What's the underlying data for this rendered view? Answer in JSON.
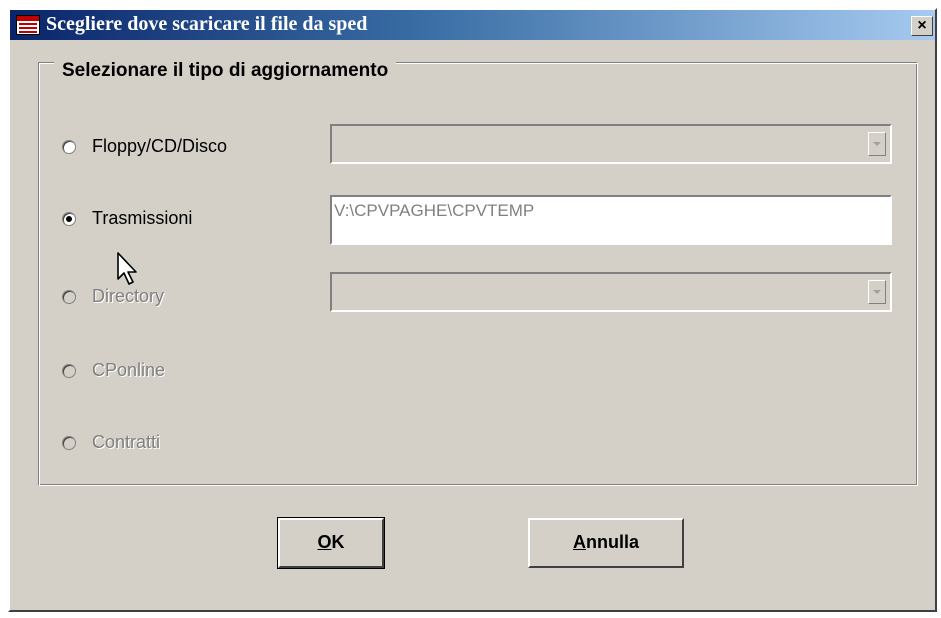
{
  "window": {
    "title": "Scegliere dove scaricare il file da sped",
    "close_glyph": "×",
    "app_icon": "window-app-icon"
  },
  "group": {
    "label": "Selezionare il tipo di aggiornamento"
  },
  "options": [
    {
      "label": "Floppy/CD/Disco",
      "checked": false,
      "enabled": true
    },
    {
      "label": "Trasmissioni",
      "checked": true,
      "enabled": true
    },
    {
      "label": "Directory",
      "checked": false,
      "enabled": false
    },
    {
      "label": "CPonline",
      "checked": false,
      "enabled": false
    },
    {
      "label": "Contratti",
      "checked": false,
      "enabled": false
    }
  ],
  "fields": {
    "floppy_combo_value": "",
    "trasmissioni_path": "V:\\CPVPAGHE\\CPVTEMP",
    "directory_combo_value": ""
  },
  "buttons": {
    "ok": {
      "mnemonic": "O",
      "rest": "K"
    },
    "cancel": {
      "mnemonic": "A",
      "rest": "nnulla"
    }
  },
  "colors": {
    "face": "#d4d0c8",
    "title_start": "#0a246a",
    "title_end": "#a6caf0"
  }
}
